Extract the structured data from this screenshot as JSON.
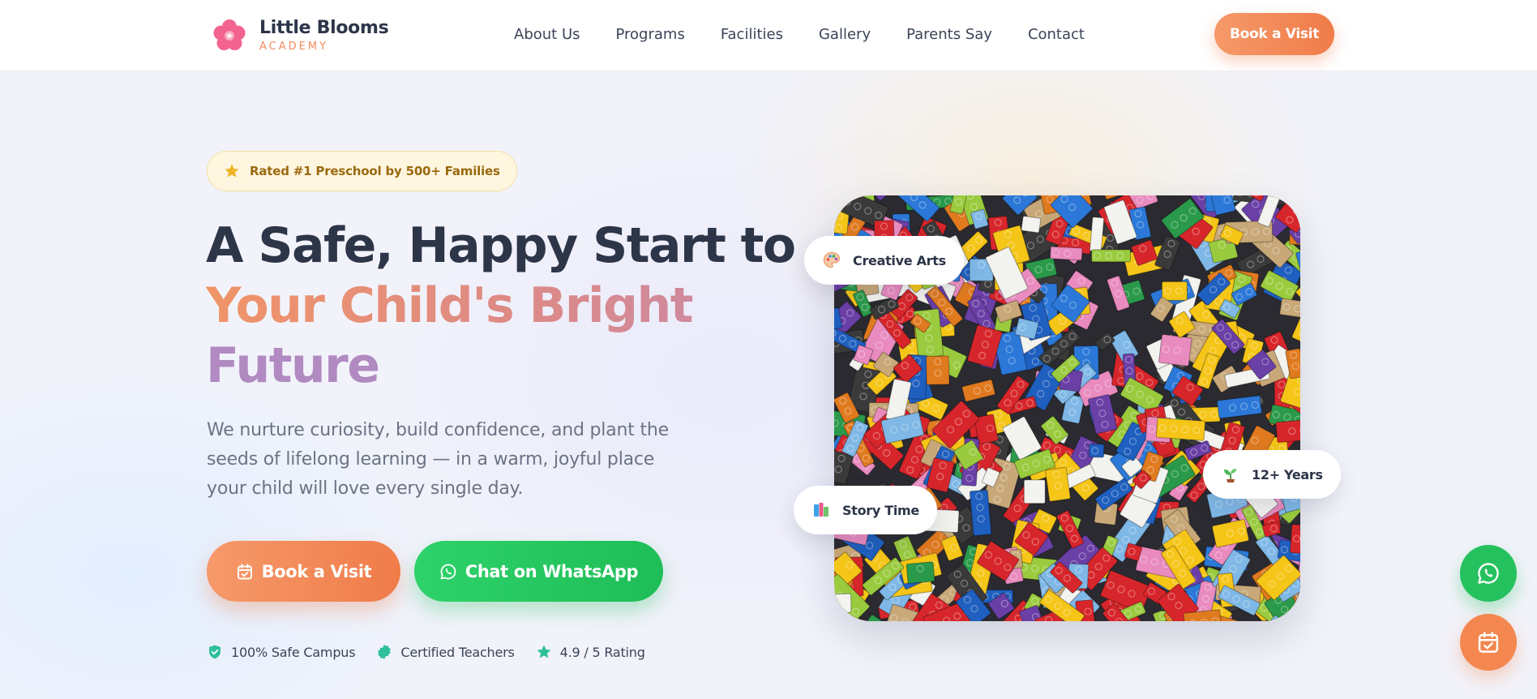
{
  "brand": {
    "title": "Little Blooms",
    "subtitle": "ACADEMY"
  },
  "nav": {
    "items": [
      "About Us",
      "Programs",
      "Facilities",
      "Gallery",
      "Parents Say",
      "Contact"
    ],
    "cta_label": "Book a Visit"
  },
  "hero": {
    "badge": "Rated #1 Preschool by 500+ Families",
    "headline_line1": "A Safe, Happy Start to",
    "headline_line2": "Your Child's Bright",
    "headline_line3": "Future",
    "lead": "We nurture curiosity, build confidence, and plant the seeds of lifelong learning — in a warm, joyful place your child will love every single day.",
    "cta_visit": "Book a Visit",
    "cta_whatsapp": "Chat on WhatsApp",
    "trust": [
      {
        "icon": "shield-check-icon",
        "label": "100% Safe Campus"
      },
      {
        "icon": "badge-check-icon",
        "label": "Certified Teachers"
      },
      {
        "icon": "star-icon",
        "label": "4.9 / 5 Rating"
      }
    ]
  },
  "photo": {
    "chips": {
      "arts": "Creative Arts",
      "story": "Story Time",
      "years": "12+ Years"
    }
  },
  "colors": {
    "orange": "#f07c49",
    "green": "#1fbd57",
    "navy": "#2d3548",
    "gold": "#9a6a0e"
  }
}
